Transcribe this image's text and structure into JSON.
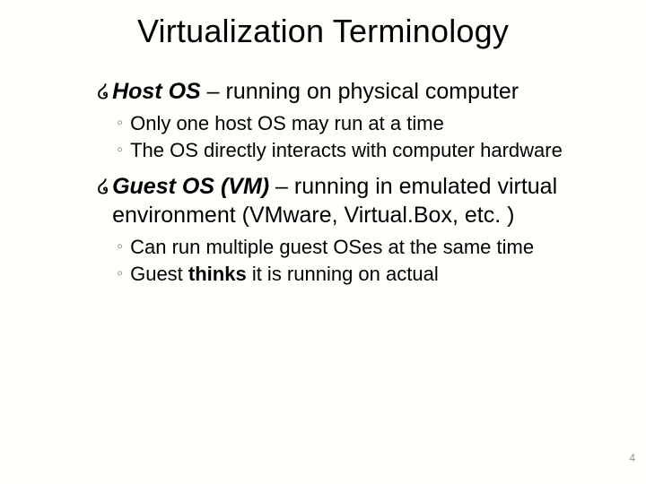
{
  "slide": {
    "title": "Virtualization Terminology",
    "bullets": [
      {
        "term": "Host OS",
        "rest": " – running on physical computer",
        "sub": [
          "Only one host OS may run at a time",
          "The OS directly interacts with computer hardware"
        ]
      },
      {
        "term": "Guest OS (VM)",
        "rest": " – running in emulated virtual environment (VMware, Virtual.Box, etc. )",
        "sub": [
          "Can run multiple guest OSes at the same time"
        ],
        "sub_special": {
          "prefix": "Guest ",
          "bold": "thinks",
          "suffix": " it is running on actual"
        }
      }
    ],
    "glyphs": {
      "l1": "໒",
      "l2": "◦"
    },
    "page_number": "4"
  }
}
